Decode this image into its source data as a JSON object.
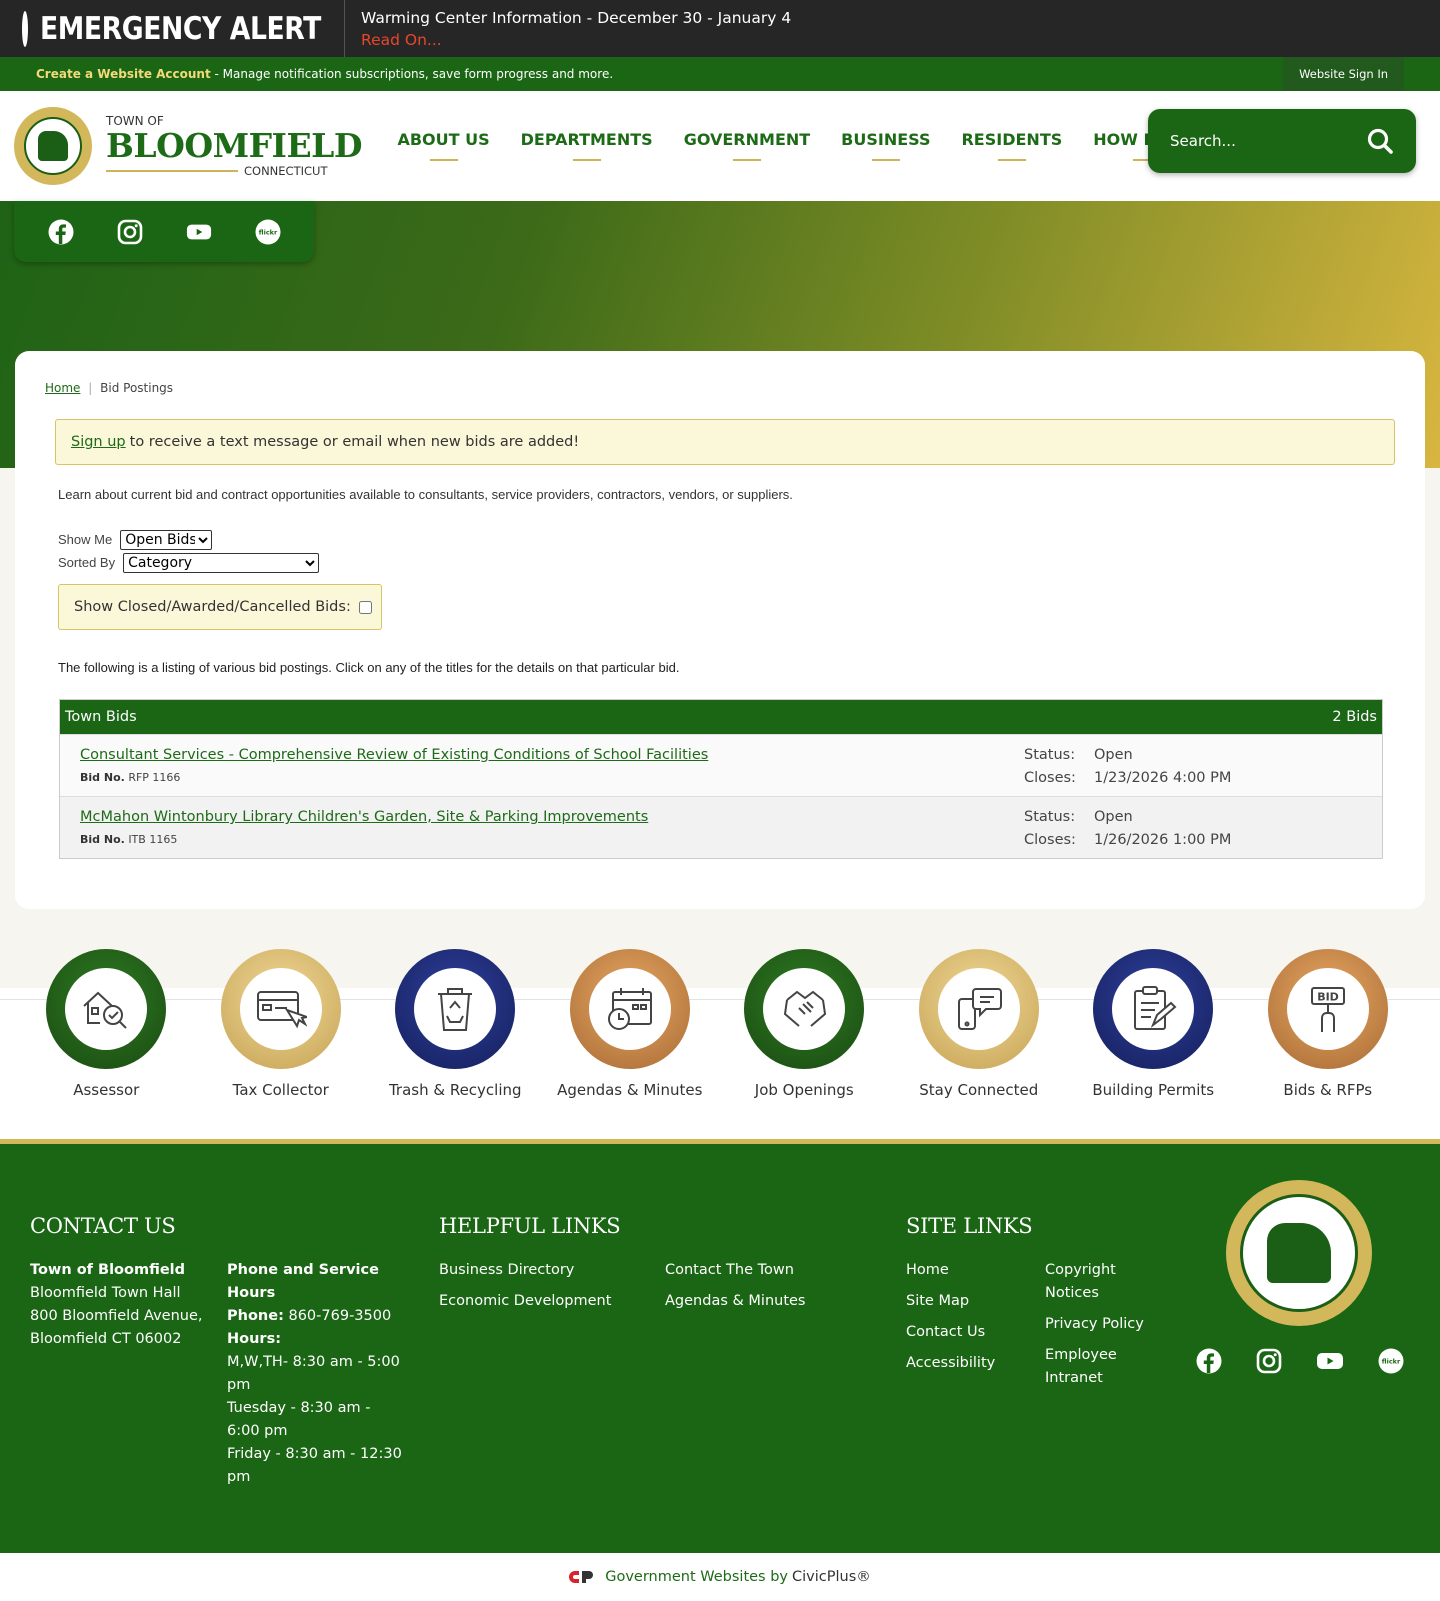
{
  "alert": {
    "title": "EMERGENCY ALERT",
    "message": "Warming Center Information - December 30 - January 4",
    "read_on": "Read On..."
  },
  "account_bar": {
    "create_link": "Create a Website Account",
    "description": " - Manage notification subscriptions, save form progress and more.",
    "sign_in": "Website Sign In"
  },
  "logo": {
    "town_of": "TOWN OF",
    "name": "BLOOMFIELD",
    "state": "CONNECTICUT"
  },
  "nav": [
    "ABOUT US",
    "DEPARTMENTS",
    "GOVERNMENT",
    "BUSINESS",
    "RESIDENTS",
    "HOW DO I..."
  ],
  "search": {
    "placeholder": "Search..."
  },
  "breadcrumb": {
    "home": "Home",
    "current": "Bid Postings"
  },
  "signup": {
    "link": "Sign up",
    "text": "to receive a text message or email when new bids are added!"
  },
  "intro": "Learn about current bid and contract opportunities available to consultants, service providers, contractors, vendors, or suppliers.",
  "filters": {
    "show_me_label": "Show Me",
    "show_me_value": "Open Bids",
    "sorted_by_label": "Sorted By",
    "sorted_by_value": "Category",
    "closed_label": "Show Closed/Awarded/Cancelled Bids:"
  },
  "listing_note": "The following is a listing of various bid postings. Click on any of the titles for the details on that particular bid.",
  "bids": {
    "category": "Town Bids",
    "count": "2 Bids",
    "bid_no_label": "Bid No.",
    "status_label": "Status:",
    "closes_label": "Closes:",
    "items": [
      {
        "title": "Consultant Services - Comprehensive Review of Existing Conditions of School Facilities",
        "bid_no": "RFP 1166",
        "status": "Open",
        "closes": "1/23/2026 4:00 PM"
      },
      {
        "title": "McMahon Wintonbury Library Children's Garden, Site & Parking Improvements",
        "bid_no": "ITB 1165",
        "status": "Open",
        "closes": "1/26/2026 1:00 PM"
      }
    ]
  },
  "quick_links": [
    {
      "label": "Assessor",
      "icon": "house-search-icon",
      "color": "#1f5a18"
    },
    {
      "label": "Tax Collector",
      "icon": "payment-click-icon",
      "color": "#d9bb6e"
    },
    {
      "label": "Trash & Recycling",
      "icon": "recycle-bin-icon",
      "color": "#1e2a78"
    },
    {
      "label": "Agendas & Minutes",
      "icon": "calendar-clock-icon",
      "color": "#c88646"
    },
    {
      "label": "Job Openings",
      "icon": "handshake-icon",
      "color": "#1f5a18"
    },
    {
      "label": "Stay Connected",
      "icon": "phone-chat-icon",
      "color": "#d9bb6e"
    },
    {
      "label": "Building Permits",
      "icon": "clipboard-pen-icon",
      "color": "#1e2a78"
    },
    {
      "label": "Bids & RFPs",
      "icon": "bid-sign-icon",
      "color": "#c88646"
    }
  ],
  "footer": {
    "contact": {
      "heading": "CONTACT US",
      "org": "Town of Bloomfield",
      "line1": "Bloomfield Town Hall",
      "line2": "800 Bloomfield Avenue,",
      "line3": "Bloomfield CT 06002",
      "phone_heading": "Phone and Service Hours",
      "phone_label": "Phone:",
      "phone": "860-769-3500",
      "hours_label": "Hours:",
      "hours1": "M,W,TH- 8:30 am - 5:00 pm",
      "hours2": "Tuesday - 8:30 am - 6:00 pm",
      "hours3": "Friday - 8:30 am - 12:30 pm"
    },
    "helpful": {
      "heading": "HELPFUL LINKS",
      "links": [
        "Business Directory",
        "Economic Development",
        "Contact The Town",
        "Agendas & Minutes"
      ]
    },
    "site": {
      "heading": "SITE LINKS",
      "links": [
        "Home",
        "Site Map",
        "Contact Us",
        "Accessibility",
        "Copyright Notices",
        "Privacy Policy",
        "Employee Intranet"
      ]
    }
  },
  "bottom": {
    "text": "Government Websites by",
    "brand": "CivicPlus®"
  },
  "colors": {
    "green": "#1a6614",
    "gold": "#d2b85a",
    "alert_red": "#e8462c"
  }
}
